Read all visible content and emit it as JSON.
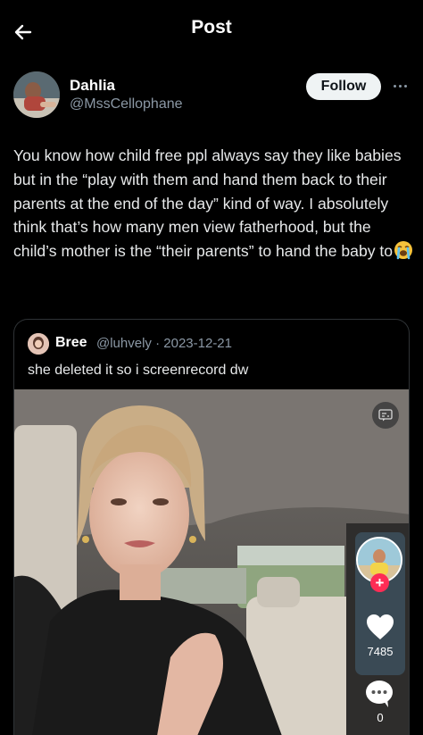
{
  "header": {
    "title": "Post",
    "back_icon": "arrow-left-icon"
  },
  "author": {
    "name": "Dahlia",
    "handle": "@MssCellophane",
    "follow_label": "Follow",
    "more_icon": "more-horizontal-icon"
  },
  "post": {
    "text": "You know how child free ppl always say they like babies but in the “play with them and hand them back to their parents at the end of the day” kind of way. I absolutely think that’s how many men view fatherhood, but the child’s mother is the “their parents” to hand the baby to",
    "emoji": "loudly-crying-face-emoji"
  },
  "quoted": {
    "name": "Bree",
    "handle": "@luhvely",
    "separator": "·",
    "date": "2023-12-21",
    "text": "she deleted it so i screenrecord dw"
  },
  "video": {
    "likes": "7485",
    "comments": "0",
    "colors": {
      "plus": "#fe2c55"
    }
  },
  "colors": {
    "background": "#000000",
    "text": "#e7e9ea",
    "secondary": "#8b98a5",
    "follow_bg": "#eff3f4",
    "border": "#2f3336"
  }
}
